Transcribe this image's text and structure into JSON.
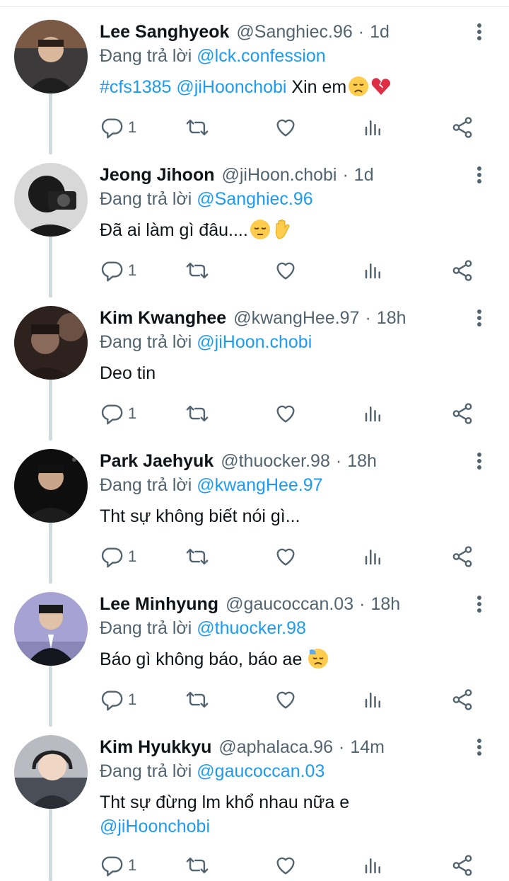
{
  "reply_prefix": "Đang trả lời",
  "tweets": [
    {
      "name": "Lee Sanghyeok",
      "handle": "@Sanghiec.96",
      "time": "1d",
      "reply_to": "@lck.confession",
      "text_parts": [
        "#cfs1385",
        "@jiHoonchobi",
        "Xin em"
      ],
      "reply_count": "1",
      "avatar_color": "#5a4a3a"
    },
    {
      "name": "Jeong Jihoon",
      "handle": "@jiHoon.chobi",
      "time": "1d",
      "reply_to": "@Sanghiec.96",
      "text_parts": [
        "Đã ai làm gì đâu...."
      ],
      "reply_count": "1",
      "avatar_color": "#2a2a2a"
    },
    {
      "name": "Kim Kwanghee",
      "handle": "@kwangHee.97",
      "time": "18h",
      "reply_to": "@jiHoon.chobi",
      "text_parts": [
        "Deo tin"
      ],
      "reply_count": "1",
      "avatar_color": "#3a2a24"
    },
    {
      "name": "Park Jaehyuk",
      "handle": "@thuocker.98",
      "time": "18h",
      "reply_to": "@kwangHee.97",
      "text_parts": [
        "Tht sự không biết nói gì..."
      ],
      "reply_count": "1",
      "avatar_color": "#141414"
    },
    {
      "name": "Lee Minhyung",
      "handle": "@gaucoccan.03",
      "time": "18h",
      "reply_to": "@thuocker.98",
      "text_parts": [
        "Báo gì không báo, báo ae"
      ],
      "reply_count": "1",
      "avatar_color": "#9a94c8"
    },
    {
      "name": "Kim Hyukkyu",
      "handle": "@aphalaca.96",
      "time": "14m",
      "reply_to": "@gaucoccan.03",
      "text_parts": [
        "Tht sự đừng lm khổ nhau nữa e",
        "@jiHoonchobi"
      ],
      "reply_count": "1",
      "avatar_color": "#6a7078"
    }
  ],
  "colors": {
    "link": "#1d9bf0",
    "secondary_text": "#536471",
    "thread_line": "#cfd9de"
  },
  "icons": [
    "reply-icon",
    "retweet-icon",
    "like-icon",
    "analytics-icon",
    "share-icon",
    "more-icon"
  ]
}
